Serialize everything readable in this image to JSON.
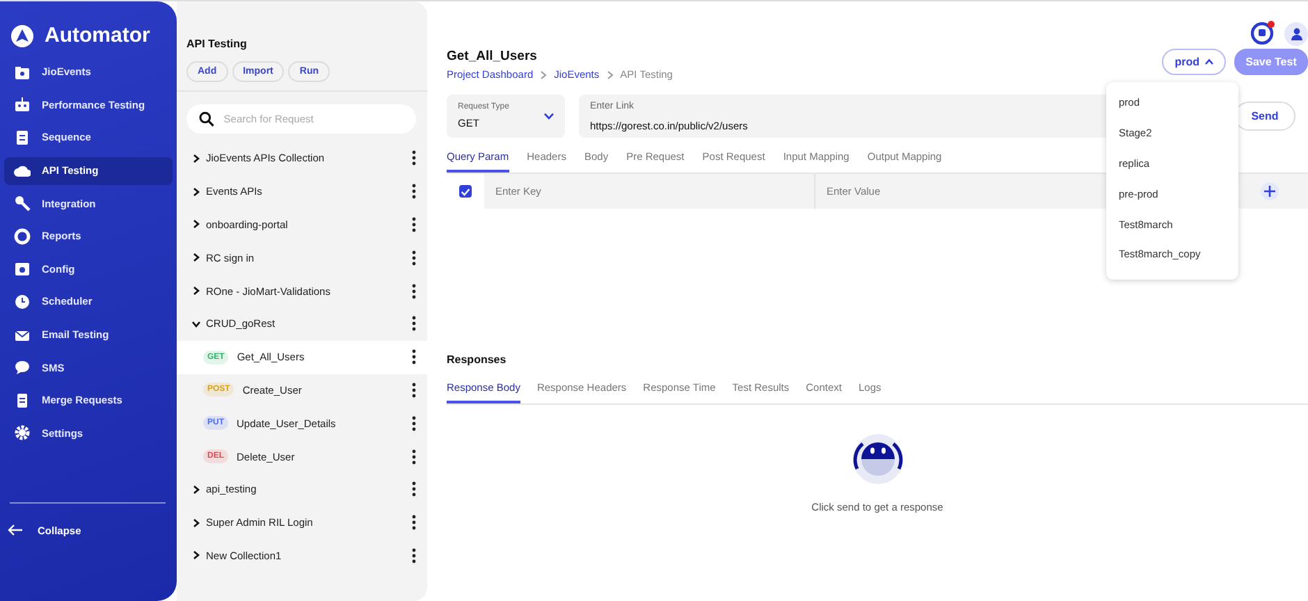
{
  "app": {
    "name": "Automator"
  },
  "sidebar": {
    "items": [
      {
        "label": "JioEvents",
        "selected": false
      },
      {
        "label": "Performance Testing",
        "selected": false
      },
      {
        "label": "Sequence",
        "selected": false
      },
      {
        "label": "API Testing",
        "selected": true
      },
      {
        "label": "Integration",
        "selected": false
      },
      {
        "label": "Reports",
        "selected": false
      },
      {
        "label": "Config",
        "selected": false
      },
      {
        "label": "Scheduler",
        "selected": false
      },
      {
        "label": "Email Testing",
        "selected": false
      },
      {
        "label": "SMS",
        "selected": false
      },
      {
        "label": "Merge Requests",
        "selected": false
      },
      {
        "label": "Settings",
        "selected": false
      }
    ],
    "collapse": "Collapse"
  },
  "collections": {
    "title": "API Testing",
    "buttons": [
      "Add",
      "Import",
      "Run"
    ],
    "search": {
      "placeholder": "Search for Request"
    },
    "items": [
      {
        "name": "JioEvents APIs Collection",
        "expanded": false
      },
      {
        "name": "Events APIs",
        "expanded": false
      },
      {
        "name": "onboarding-portal",
        "expanded": false
      },
      {
        "name": "RC sign in",
        "expanded": false
      },
      {
        "name": "ROne - JioMart-Validations",
        "expanded": false
      },
      {
        "name": "CRUD_goRest",
        "expanded": true,
        "children": [
          {
            "method": "GET",
            "color": "#2fb36b",
            "name": "Get_All_Users",
            "selected": true
          },
          {
            "method": "POST",
            "color": "#d9a21b",
            "name": "Create_User",
            "selected": false
          },
          {
            "method": "PUT",
            "color": "#4a6cf0",
            "name": "Update_User_Details",
            "selected": false
          },
          {
            "method": "DEL",
            "color": "#e2474f",
            "name": "Delete_User",
            "selected": false
          }
        ]
      },
      {
        "name": "api_testing",
        "expanded": false
      },
      {
        "name": "Super Admin RIL Login",
        "expanded": false
      },
      {
        "name": "New Collection1",
        "expanded": false
      }
    ]
  },
  "request": {
    "title": "Get_All_Users",
    "breadcrumb": [
      "Project Dashboard",
      "JioEvents",
      "API Testing"
    ],
    "environment": {
      "value": "prod",
      "expanded": true,
      "options": [
        "prod",
        "Stage2",
        "replica",
        "pre-prod",
        "Test8march",
        "Test8march_copy"
      ]
    },
    "save_button": "Save Test",
    "request_type": {
      "label": "Request Type",
      "value": "GET"
    },
    "link": {
      "label": "Enter Link",
      "value": "https://gorest.co.in/public/v2/users"
    },
    "send_button": "Send",
    "tabs": [
      {
        "label": "Query Param",
        "selected": true
      },
      {
        "label": "Headers",
        "selected": false
      },
      {
        "label": "Body",
        "selected": false
      },
      {
        "label": "Pre Request",
        "selected": false
      },
      {
        "label": "Post Request",
        "selected": false
      },
      {
        "label": "Input Mapping",
        "selected": false
      },
      {
        "label": "Output Mapping",
        "selected": false
      }
    ],
    "param_row": {
      "checked": true,
      "key_placeholder": "Enter Key",
      "value_placeholder": "Enter Value"
    }
  },
  "responses": {
    "title": "Responses",
    "tabs": [
      {
        "label": "Response Body",
        "selected": true
      },
      {
        "label": "Response Headers",
        "selected": false
      },
      {
        "label": "Response Time",
        "selected": false
      },
      {
        "label": "Test Results",
        "selected": false
      },
      {
        "label": "Context",
        "selected": false
      },
      {
        "label": "Logs",
        "selected": false
      }
    ],
    "empty_message": "Click send to get a response"
  },
  "notifications": {
    "unread": true
  }
}
